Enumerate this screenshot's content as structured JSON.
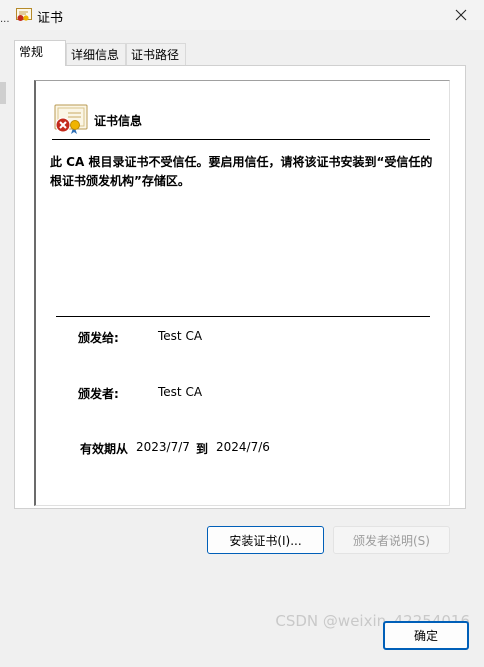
{
  "window": {
    "title": "证书",
    "edge_text": "..."
  },
  "tabs": [
    {
      "label": "常规"
    },
    {
      "label": "详细信息"
    },
    {
      "label": "证书路径"
    }
  ],
  "info": {
    "heading": "证书信息",
    "warning": "此 CA 根目录证书不受信任。要启用信任，请将该证书安装到“受信任的根证书颁发机构”存储区。"
  },
  "fields": {
    "issued_to_label": "颁发给:",
    "issued_to_value": "Test CA",
    "issued_by_label": "颁发者:",
    "issued_by_value": "Test CA",
    "valid_label": "有效期从",
    "valid_from": "2023/7/7",
    "valid_to_label": "到",
    "valid_to": "2024/7/6"
  },
  "buttons": {
    "install": "安装证书(I)...",
    "issuer_statement": "颁发者说明(S)",
    "ok": "确定"
  },
  "watermark": "CSDN @weixin_42254016",
  "icons": {
    "window": "certificate-icon",
    "cert_error": "certificate-error-icon",
    "close": "close-icon"
  },
  "colors": {
    "accent": "#005fb8",
    "error_badge": "#c42b1c",
    "ribbon": "#f0b400"
  }
}
